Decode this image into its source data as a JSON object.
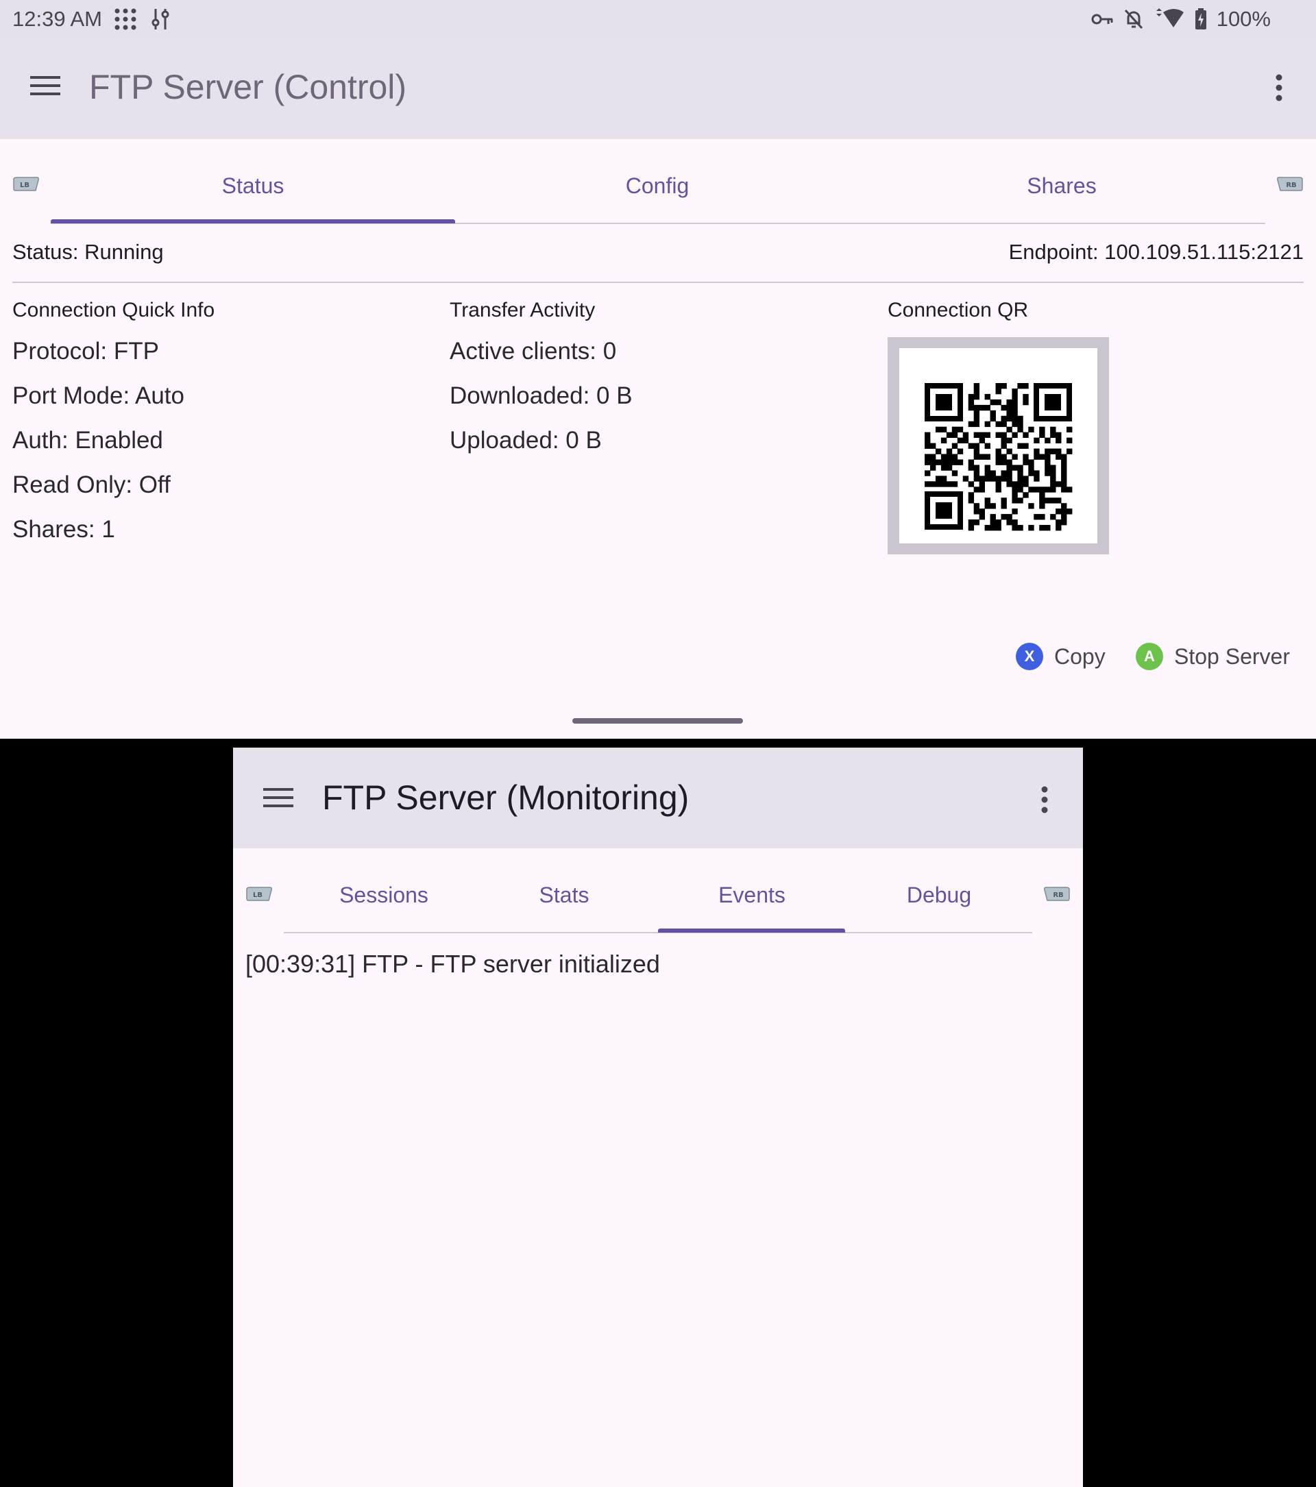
{
  "status_bar": {
    "time": "12:39 AM",
    "battery": "100%",
    "left_icons": [
      "apps-grid-icon",
      "tune-icon"
    ],
    "right_icons": [
      "vpn-key-icon",
      "notifications-off-icon",
      "wifi-icon",
      "battery-charging-icon"
    ]
  },
  "control": {
    "title": "FTP Server (Control)",
    "tabs": [
      "Status",
      "Config",
      "Shares"
    ],
    "selected_tab": "Status",
    "status": "Status: Running",
    "endpoint": "Endpoint: 100.109.51.115:2121",
    "quick_info": {
      "heading": "Connection Quick Info",
      "lines": [
        "Protocol: FTP",
        "Port Mode: Auto",
        "Auth: Enabled",
        "Read Only: Off",
        "Shares: 1"
      ]
    },
    "transfer": {
      "heading": "Transfer Activity",
      "lines": [
        "Active clients: 0",
        "Downloaded: 0 B",
        "Uploaded: 0 B"
      ]
    },
    "qr": {
      "heading": "Connection QR"
    },
    "actions": {
      "copy_key": "X",
      "copy_label": "Copy",
      "stop_key": "A",
      "stop_label": "Stop Server"
    }
  },
  "monitoring": {
    "title": "FTP Server (Monitoring)",
    "tabs": [
      "Sessions",
      "Stats",
      "Events",
      "Debug"
    ],
    "selected_tab": "Events",
    "events": [
      "[00:39:31] FTP - FTP server initialized"
    ]
  },
  "bumpers": {
    "left": "LB",
    "right": "RB"
  },
  "colors": {
    "accent": "#6650a4",
    "appbar": "#e7e1ec",
    "surface": "#fdf7fd",
    "x_button": "#3f5fe0",
    "a_button": "#6cc24a"
  }
}
